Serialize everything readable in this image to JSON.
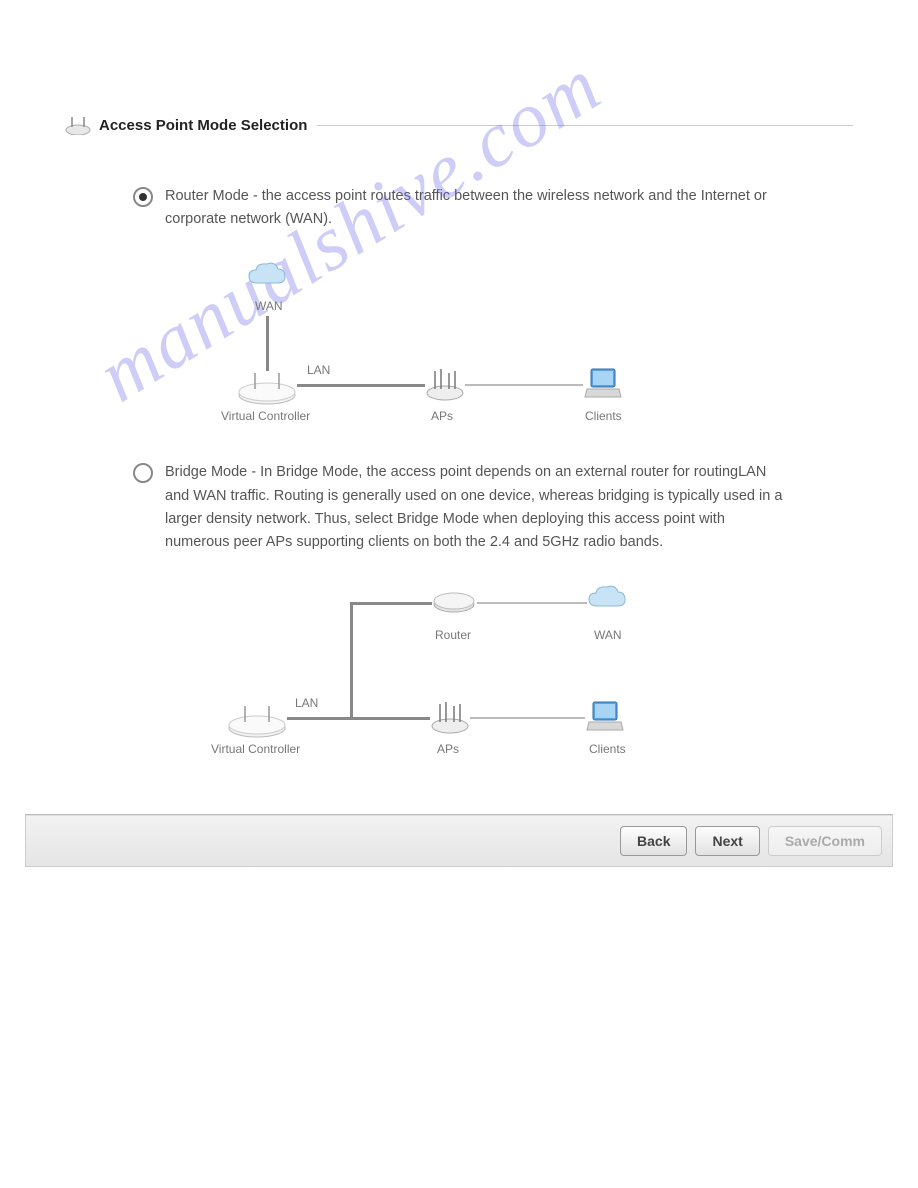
{
  "section_title": "Access Point Mode Selection",
  "options": {
    "router": {
      "text": "Router Mode - the access point routes traffic between the wireless network and the Internet or corporate network (WAN).",
      "selected": true,
      "diagram": {
        "wan": "WAN",
        "lan": "LAN",
        "virtual_controller": "Virtual Controller",
        "aps": "APs",
        "clients": "Clients"
      }
    },
    "bridge": {
      "text": "Bridge Mode - In Bridge Mode, the access point depends on an external router for routingLAN and WAN traffic. Routing is generally used on one device, whereas bridging is typically used in a larger density network. Thus, select Bridge Mode when deploying this access point with numerous peer APs supporting clients on both the 2.4 and 5GHz radio bands.",
      "selected": false,
      "diagram": {
        "virtual_controller": "Virtual Controller",
        "lan": "LAN",
        "router": "Router",
        "wan": "WAN",
        "aps": "APs",
        "clients": "Clients"
      }
    }
  },
  "buttons": {
    "back": "Back",
    "next": "Next",
    "save_commit": "Save/Comm"
  },
  "watermark": "manualshive.com"
}
